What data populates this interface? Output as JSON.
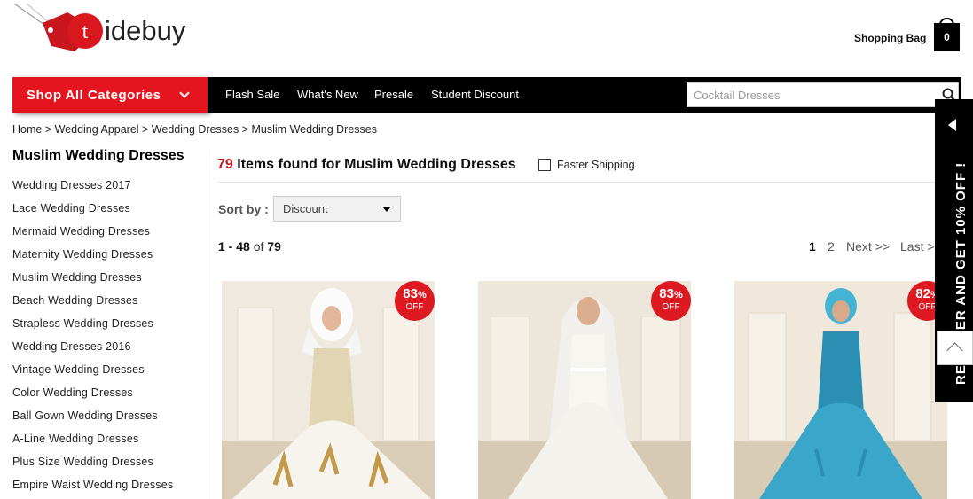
{
  "logo": {
    "letter": "t",
    "text": "idebuy"
  },
  "header": {
    "bag_label": "Shopping Bag",
    "bag_count": "0"
  },
  "nav": {
    "shop_all": "Shop All Categories",
    "links": [
      "Flash Sale",
      "What's New",
      "Presale",
      "Student Discount"
    ],
    "search_placeholder": "Cocktail Dresses"
  },
  "breadcrumb": [
    "Home",
    "Wedding Apparel",
    "Wedding Dresses",
    "Muslim Wedding Dresses"
  ],
  "breadcrumb_sep": " > ",
  "sidebar": {
    "title": "Muslim Wedding Dresses",
    "items": [
      "Wedding Dresses 2017",
      "Lace Wedding Dresses",
      "Mermaid Wedding Dresses",
      "Maternity Wedding Dresses",
      "Muslim Wedding Dresses",
      "Beach Wedding Dresses",
      "Strapless Wedding Dresses",
      "Wedding Dresses 2016",
      "Vintage Wedding Dresses",
      "Color Wedding Dresses",
      "Ball Gown Wedding Dresses",
      "A-Line Wedding Dresses",
      "Plus Size Wedding Dresses",
      "Empire Waist Wedding Dresses"
    ]
  },
  "results": {
    "count": "79",
    "found_text": " Items found for ",
    "query": "Muslim Wedding Dresses",
    "faster_shipping": "Faster Shipping",
    "sort_label": "Sort by :",
    "sort_value": "Discount",
    "range": "1 - 48",
    "of_text": " of ",
    "total": "79",
    "pages": {
      "current": "1",
      "next_page": "2",
      "next": "Next >>",
      "last": "Last >"
    }
  },
  "products": [
    {
      "discount": "83",
      "pct": "%",
      "off": "OFF",
      "dress": "#f7f4ee",
      "accent": "#c29a4b"
    },
    {
      "discount": "83",
      "pct": "%",
      "off": "OFF",
      "dress": "#f4f2ec",
      "accent": "#ffffff"
    },
    {
      "discount": "82",
      "pct": "%",
      "off": "OFF",
      "dress": "#3aa6c9",
      "accent": "#2a8fb2"
    }
  ],
  "register_tab": "REGISTER AND GET 10% OFF !",
  "colors": {
    "brand_red": "#e4151f",
    "badge_red": "#dd1a22",
    "nav_black": "#000000"
  }
}
